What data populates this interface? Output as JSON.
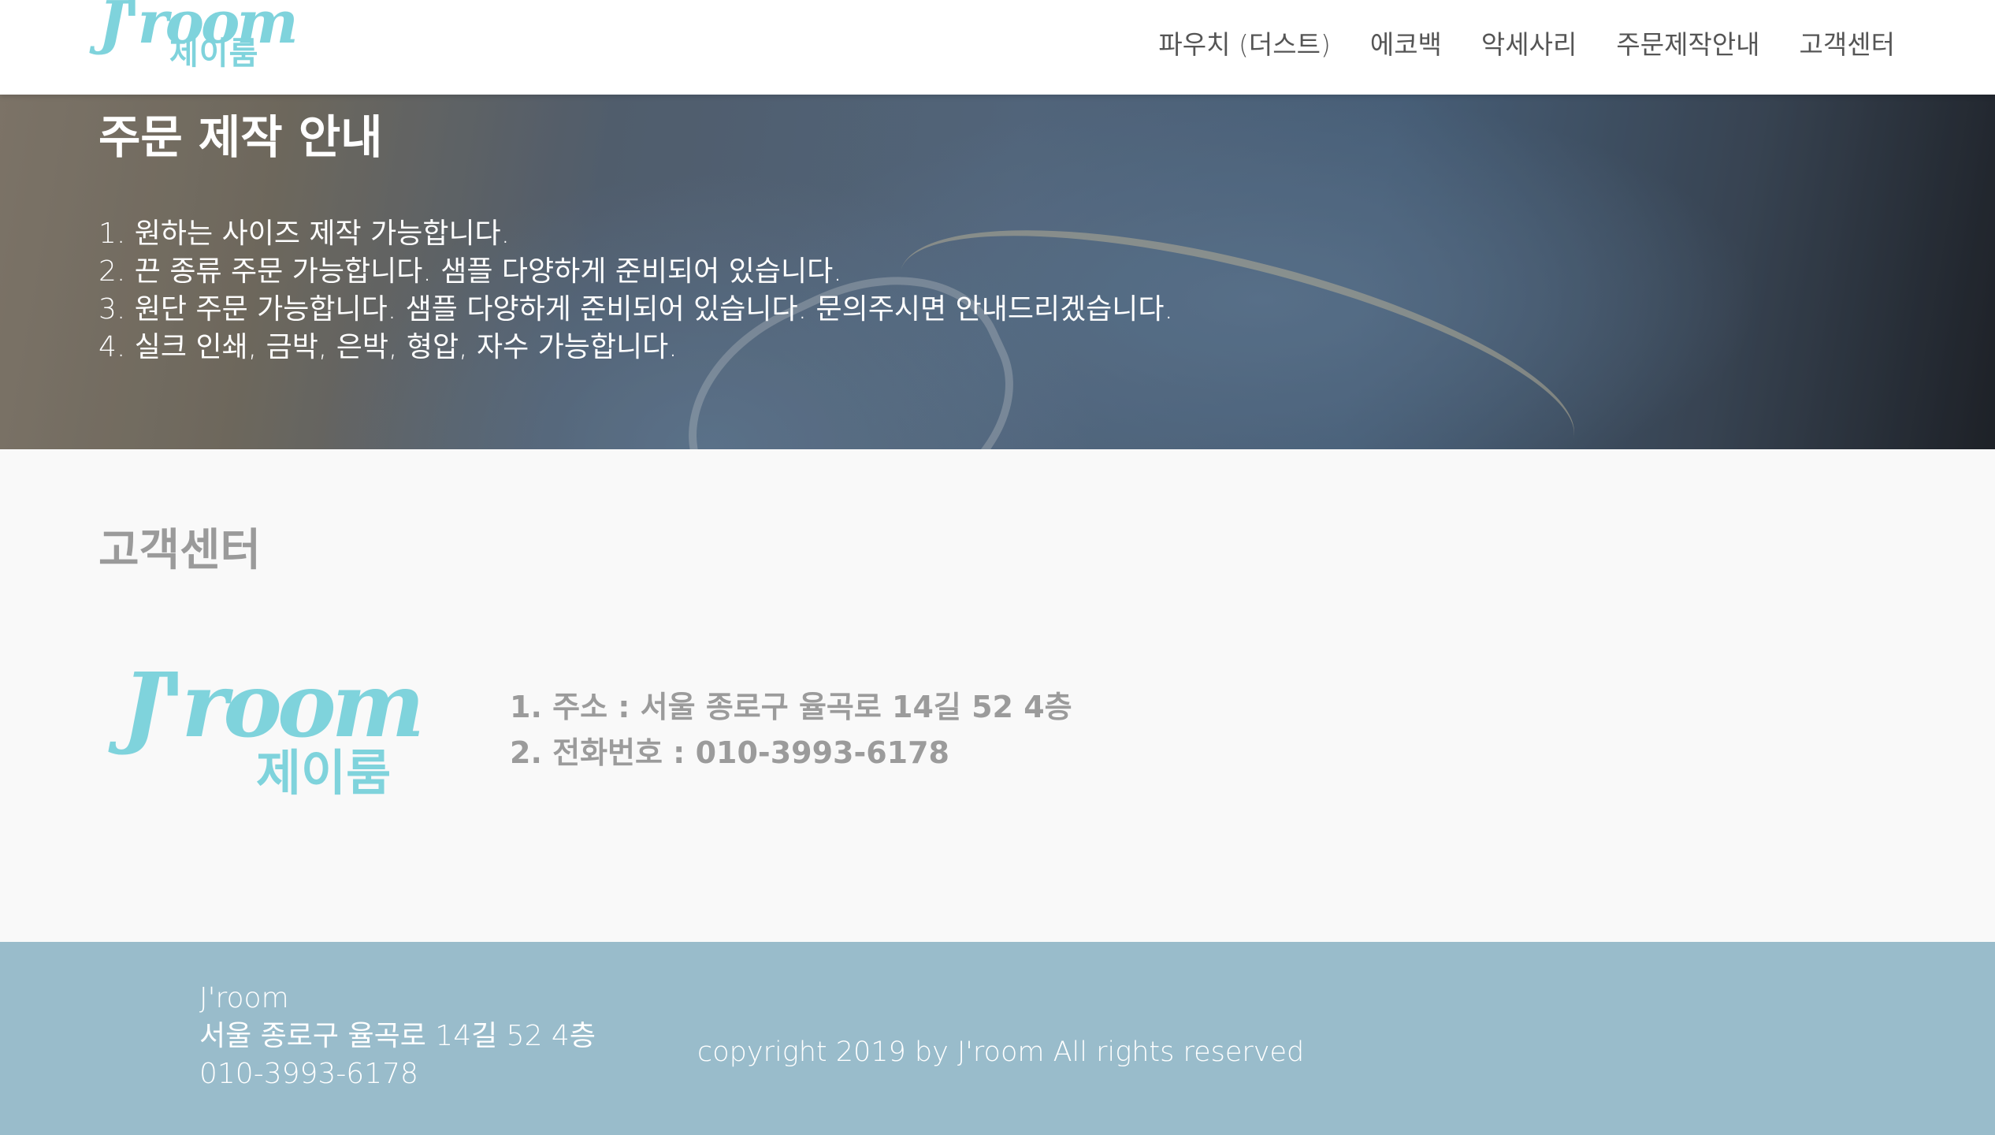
{
  "header": {
    "logo": {
      "wordmark": "J'room",
      "korean": "제이룸"
    },
    "nav": [
      {
        "label": "파우치 (더스트)"
      },
      {
        "label": "에코백"
      },
      {
        "label": "악세사리"
      },
      {
        "label": "주문제작안내"
      },
      {
        "label": "고객센터"
      }
    ]
  },
  "hero": {
    "title": "주문 제작 안내",
    "items": [
      "1. 원하는 사이즈 제작 가능합니다.",
      "2. 끈 종류 주문 가능합니다. 샘플 다양하게 준비되어 있습니다.",
      "3. 원단 주문 가능합니다. 샘플 다양하게 준비되어 있습니다. 문의주시면 안내드리겠습니다.",
      "4. 실크 인쇄, 금박, 은박, 형압, 자수 가능합니다."
    ]
  },
  "customer_center": {
    "title": "고객센터",
    "logo": {
      "wordmark": "J'room",
      "korean": "제이룸"
    },
    "info": [
      "1. 주소 : 서울 종로구 율곡로 14길 52 4층",
      "2. 전화번호 : 010-3993-6178"
    ]
  },
  "footer": {
    "name": "J'room",
    "address": "서울 종로구 율곡로 14길 52 4층",
    "phone": "010-3993-6178",
    "copyright": "copyright 2019 by J'room All rights reserved"
  },
  "colors": {
    "brand": "#7fd3dc",
    "footer_bg": "#99bccb",
    "muted_text": "#9b9b9b"
  }
}
